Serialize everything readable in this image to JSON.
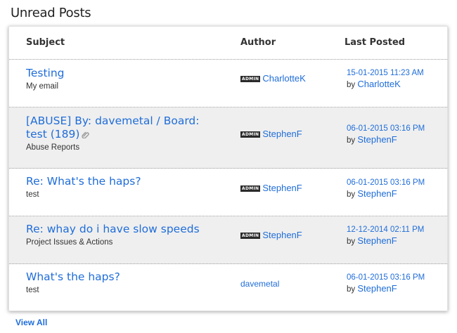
{
  "heading": "Unread Posts",
  "columns": {
    "subject": "Subject",
    "author": "Author",
    "last_posted": "Last Posted"
  },
  "badge_label": "ADMIN",
  "by_label": "by",
  "rows": [
    {
      "subject": "Testing",
      "board": "My email",
      "author": "CharlotteK",
      "author_admin": true,
      "posted_date": "15-01-2015 11:23 AM",
      "posted_by": "CharlotteK"
    },
    {
      "subject": "[ABUSE] By: davemetal / Board: test (189)",
      "board": "Abuse Reports",
      "author": "StephenF",
      "author_admin": true,
      "posted_date": "06-01-2015 03:16 PM",
      "posted_by": "StephenF",
      "has_attachment": true
    },
    {
      "subject": "Re: What's the haps?",
      "board": "test",
      "author": "StephenF",
      "author_admin": true,
      "posted_date": "06-01-2015 03:16 PM",
      "posted_by": "StephenF"
    },
    {
      "subject": "Re: whay do i have slow speeds",
      "board": "Project Issues & Actions",
      "author": "StephenF",
      "author_admin": true,
      "posted_date": "12-12-2014 02:11 PM",
      "posted_by": "StephenF"
    },
    {
      "subject": "What's the haps?",
      "board": "test",
      "author": "davemetal",
      "author_admin": false,
      "posted_date": "06-01-2015 03:16 PM",
      "posted_by": "StephenF"
    }
  ],
  "view_all": "View All",
  "colors": {
    "link": "#1f6dd9",
    "alt_row": "#efefef",
    "badge_bg": "#2a2a2a"
  }
}
